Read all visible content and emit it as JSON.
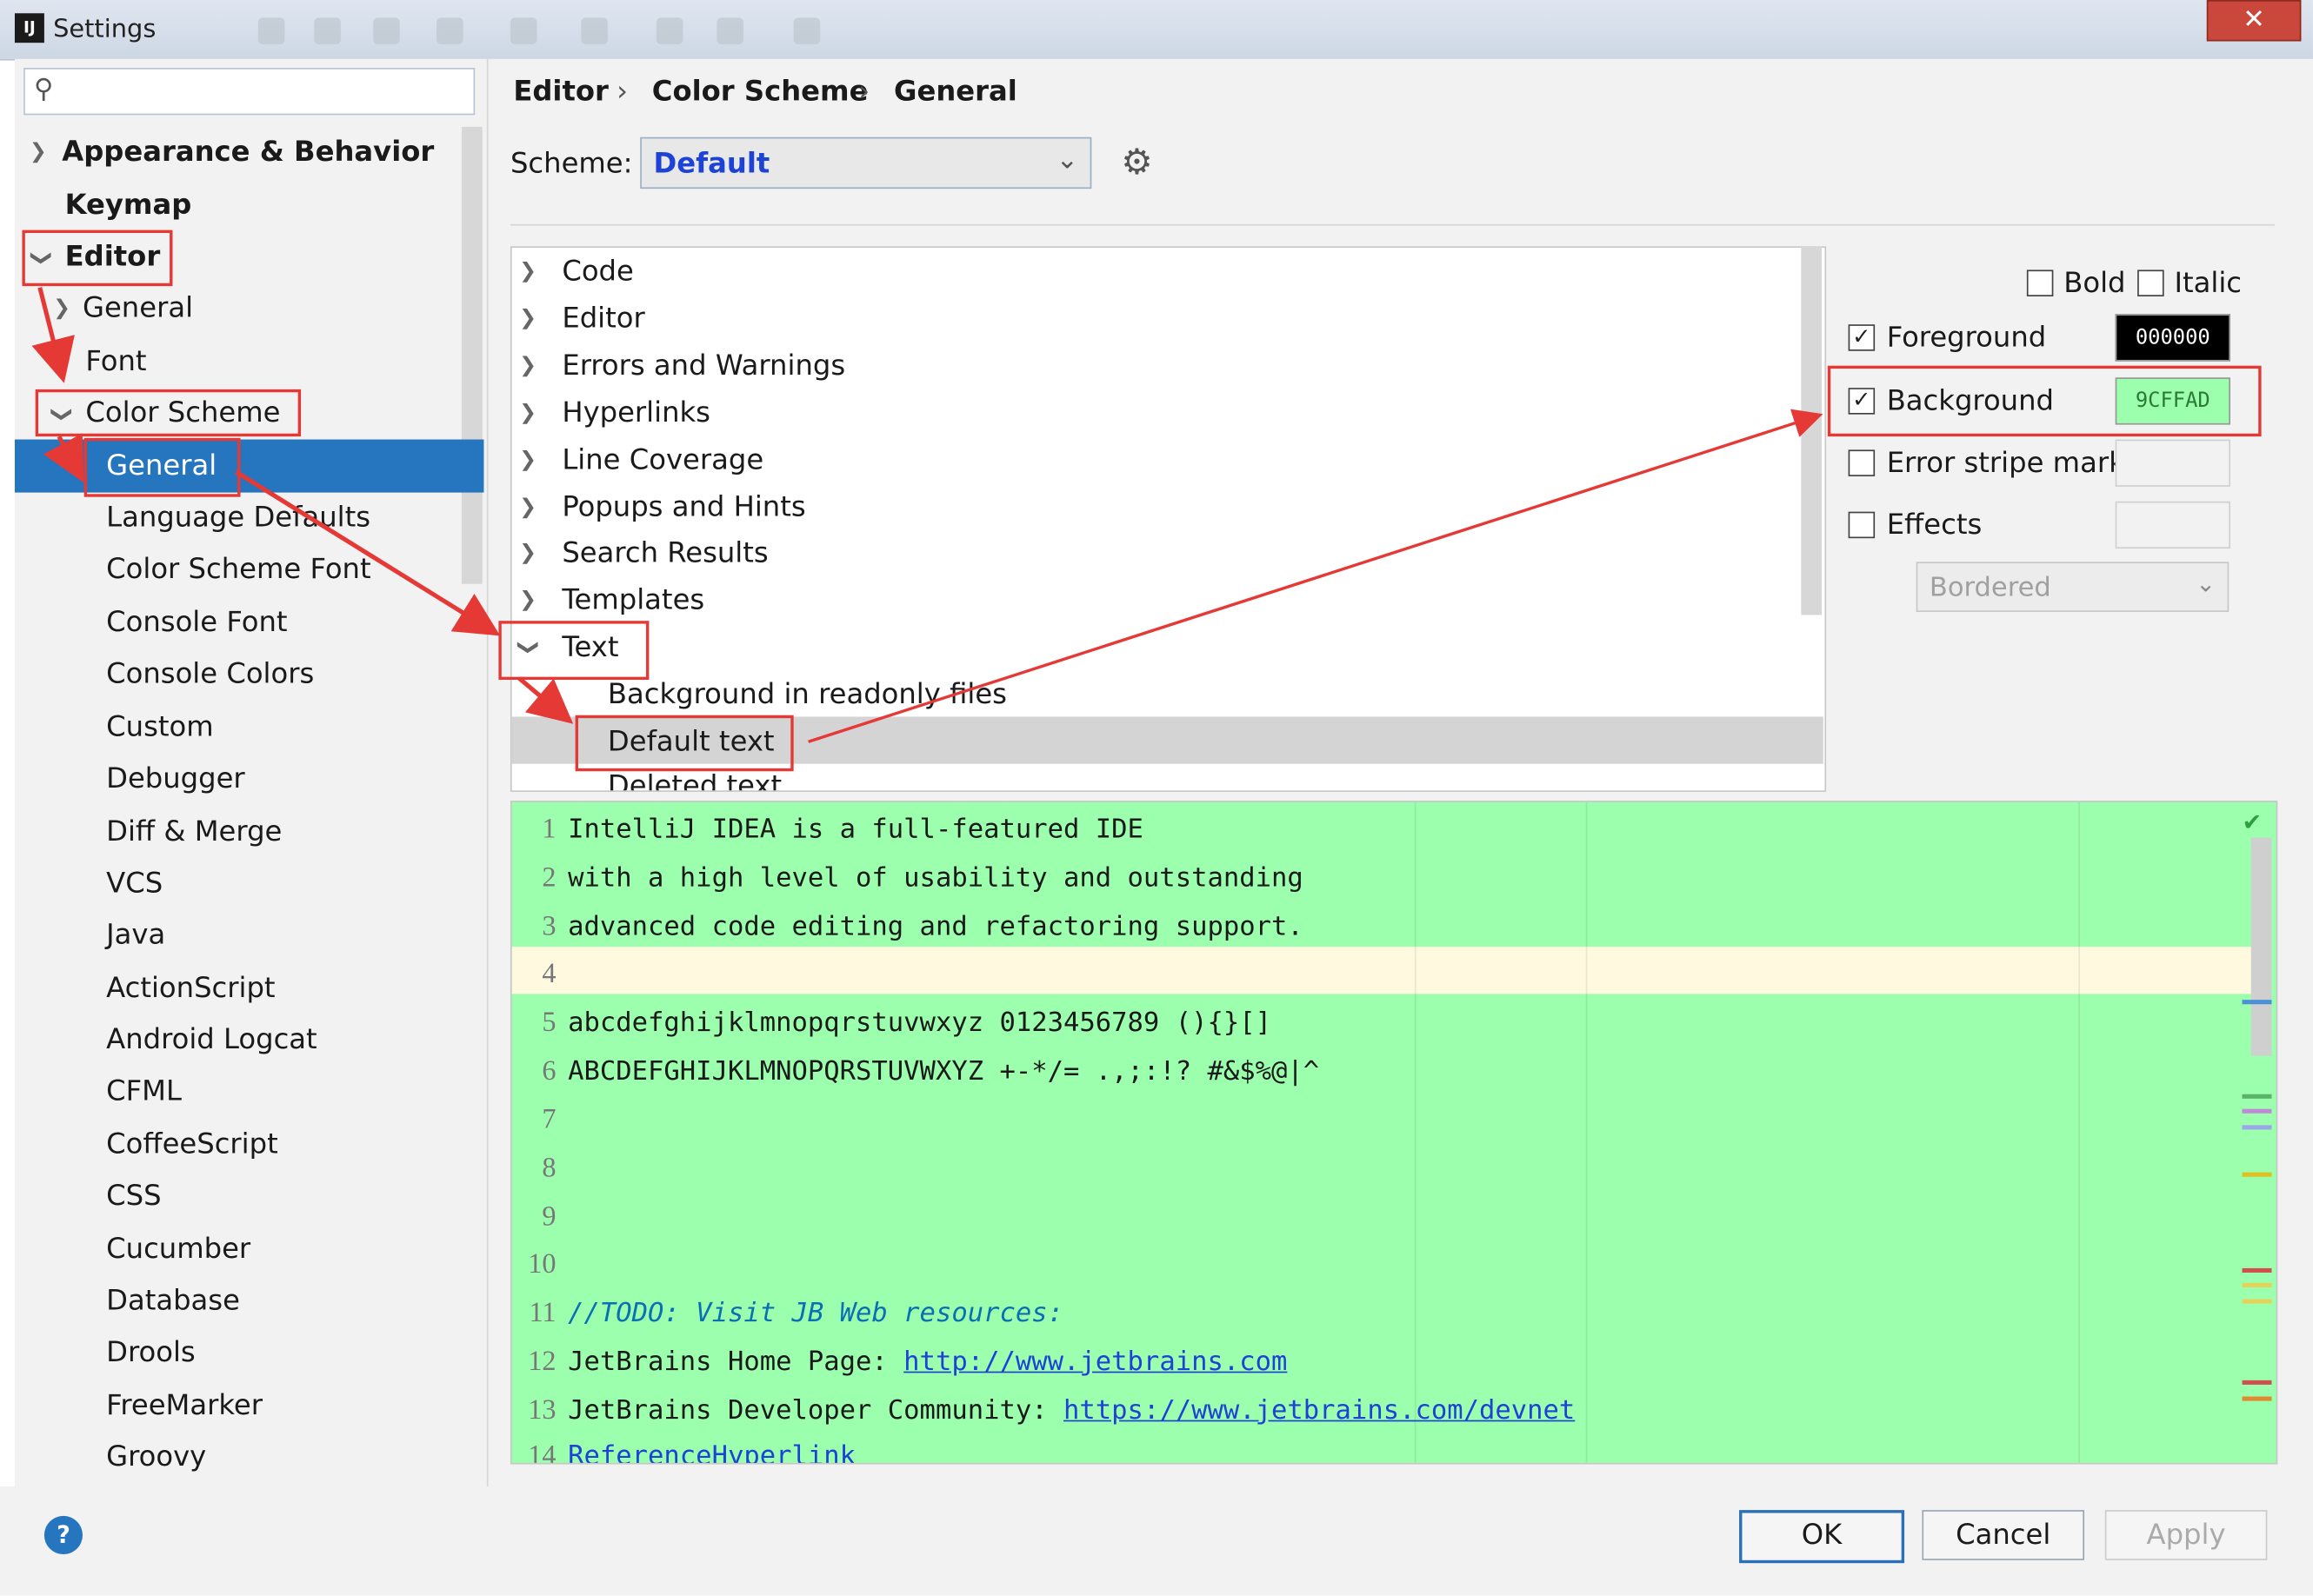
{
  "window": {
    "title": "Settings",
    "logo_text": "IJ",
    "close_label": "✕"
  },
  "search": {
    "placeholder": "",
    "icon": "search-icon"
  },
  "sidebar": {
    "items": [
      {
        "label": "Appearance & Behavior",
        "bold": true
      },
      {
        "label": "Keymap",
        "bold": true
      },
      {
        "label": "Editor",
        "bold": true
      },
      {
        "label": "General"
      },
      {
        "label": "Font"
      },
      {
        "label": "Color Scheme"
      },
      {
        "label": "General",
        "selected": true
      },
      {
        "label": "Language Defaults"
      },
      {
        "label": "Color Scheme Font"
      },
      {
        "label": "Console Font"
      },
      {
        "label": "Console Colors"
      },
      {
        "label": "Custom"
      },
      {
        "label": "Debugger"
      },
      {
        "label": "Diff & Merge"
      },
      {
        "label": "VCS"
      },
      {
        "label": "Java"
      },
      {
        "label": "ActionScript"
      },
      {
        "label": "Android Logcat"
      },
      {
        "label": "CFML"
      },
      {
        "label": "CoffeeScript"
      },
      {
        "label": "CSS"
      },
      {
        "label": "Cucumber"
      },
      {
        "label": "Database"
      },
      {
        "label": "Drools"
      },
      {
        "label": "FreeMarker"
      },
      {
        "label": "Groovy"
      }
    ]
  },
  "breadcrumb": [
    "Editor",
    "Color Scheme",
    "General"
  ],
  "scheme": {
    "label": "Scheme:",
    "value": "Default"
  },
  "attributes": {
    "items": [
      {
        "label": "Code"
      },
      {
        "label": "Editor"
      },
      {
        "label": "Errors and Warnings"
      },
      {
        "label": "Hyperlinks"
      },
      {
        "label": "Line Coverage"
      },
      {
        "label": "Popups and Hints"
      },
      {
        "label": "Search Results"
      },
      {
        "label": "Templates"
      },
      {
        "label": "Text",
        "expanded": true
      },
      {
        "label": "Background in readonly files"
      },
      {
        "label": "Default text",
        "selected": true
      },
      {
        "label": "Deleted text"
      }
    ]
  },
  "props": {
    "bold_label": "Bold",
    "italic_label": "Italic",
    "foreground_label": "Foreground",
    "foreground_value": "000000",
    "background_label": "Background",
    "background_value": "9CFFAD",
    "error_stripe_label": "Error stripe mark",
    "effects_label": "Effects",
    "effects_type": "Bordered",
    "foreground_checked": true,
    "background_checked": true,
    "foreground_color": "#000000",
    "background_color": "#9CFFAD"
  },
  "preview": {
    "lines": [
      {
        "n": "1",
        "text": "IntelliJ IDEA is a full-featured IDE"
      },
      {
        "n": "2",
        "text": "with a high level of usability and outstanding"
      },
      {
        "n": "3",
        "text": "advanced code editing and refactoring support."
      },
      {
        "n": "4",
        "text": ""
      },
      {
        "n": "5",
        "text": "abcdefghijklmnopqrstuvwxyz 0123456789 (){}[]"
      },
      {
        "n": "6",
        "text": "ABCDEFGHIJKLMNOPQRSTUVWXYZ +-*/= .,;:!? #&$%@|^"
      },
      {
        "n": "7",
        "text": ""
      },
      {
        "n": "8",
        "text": ""
      },
      {
        "n": "9",
        "text": ""
      },
      {
        "n": "10",
        "text": ""
      },
      {
        "n": "11",
        "text": "//TODO: Visit JB Web resources:"
      },
      {
        "n": "12",
        "text": "JetBrains Home Page: ",
        "link": "http://www.jetbrains.com"
      },
      {
        "n": "13",
        "text": "JetBrains Developer Community: ",
        "link": "https://www.jetbrains.com/devnet"
      },
      {
        "n": "14",
        "text": "ReferenceHyperlink"
      }
    ]
  },
  "buttons": {
    "ok": "OK",
    "cancel": "Cancel",
    "apply": "Apply",
    "help": "?"
  },
  "colors": {
    "selection": "#2675bf",
    "highlight_red": "#e53935",
    "preview_bg": "#9CFFAD",
    "todo": "#0a6fb3",
    "link": "#1c43d6"
  }
}
